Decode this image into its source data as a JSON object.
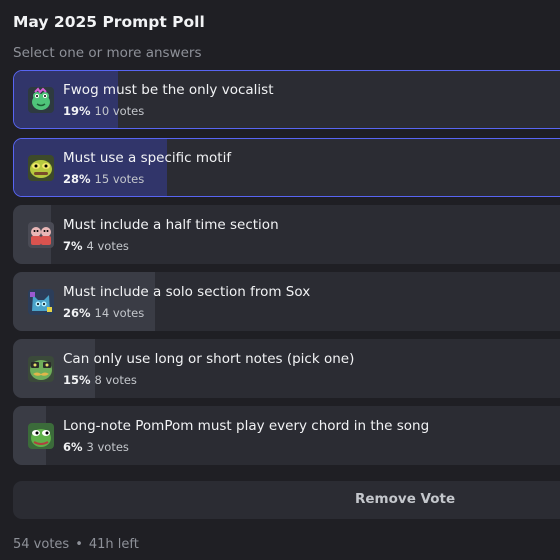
{
  "poll": {
    "title": "May 2025 Prompt Poll",
    "subtitle": "Select one or more answers",
    "options": [
      {
        "label": "Fwog must be the only vocalist",
        "percent": "19%",
        "votes": "10 votes",
        "share": 0.19,
        "selected": true,
        "icon": "green-frog-icon",
        "fill_color": "#31356a"
      },
      {
        "label": "Must use a specific motif",
        "percent": "28%",
        "votes": "15 votes",
        "share": 0.28,
        "selected": true,
        "icon": "yellow-frog-icon",
        "fill_color": "#31356a"
      },
      {
        "label": "Must include a half time section",
        "percent": "7%",
        "votes": "4 votes",
        "share": 0.07,
        "selected": false,
        "icon": "pink-pair-icon",
        "fill_color": "#3a3c45"
      },
      {
        "label": "Must include a solo section from Sox",
        "percent": "26%",
        "votes": "14 votes",
        "share": 0.26,
        "selected": false,
        "icon": "blue-cat-icon",
        "fill_color": "#3a3c45"
      },
      {
        "label": "Can only use long or short notes (pick one)",
        "percent": "15%",
        "votes": "8 votes",
        "share": 0.15,
        "selected": false,
        "icon": "mustache-frog-icon",
        "fill_color": "#3a3c45"
      },
      {
        "label": "Long-note PomPom must play every chord in the song",
        "percent": "6%",
        "votes": "3 votes",
        "share": 0.06,
        "selected": false,
        "icon": "pepe-frog-icon",
        "fill_color": "#3a3c45"
      }
    ],
    "remove_label": "Remove Vote",
    "total_votes": "54 votes",
    "separator": "•",
    "time_left": "41h left",
    "accent_color": "#5865f2"
  }
}
